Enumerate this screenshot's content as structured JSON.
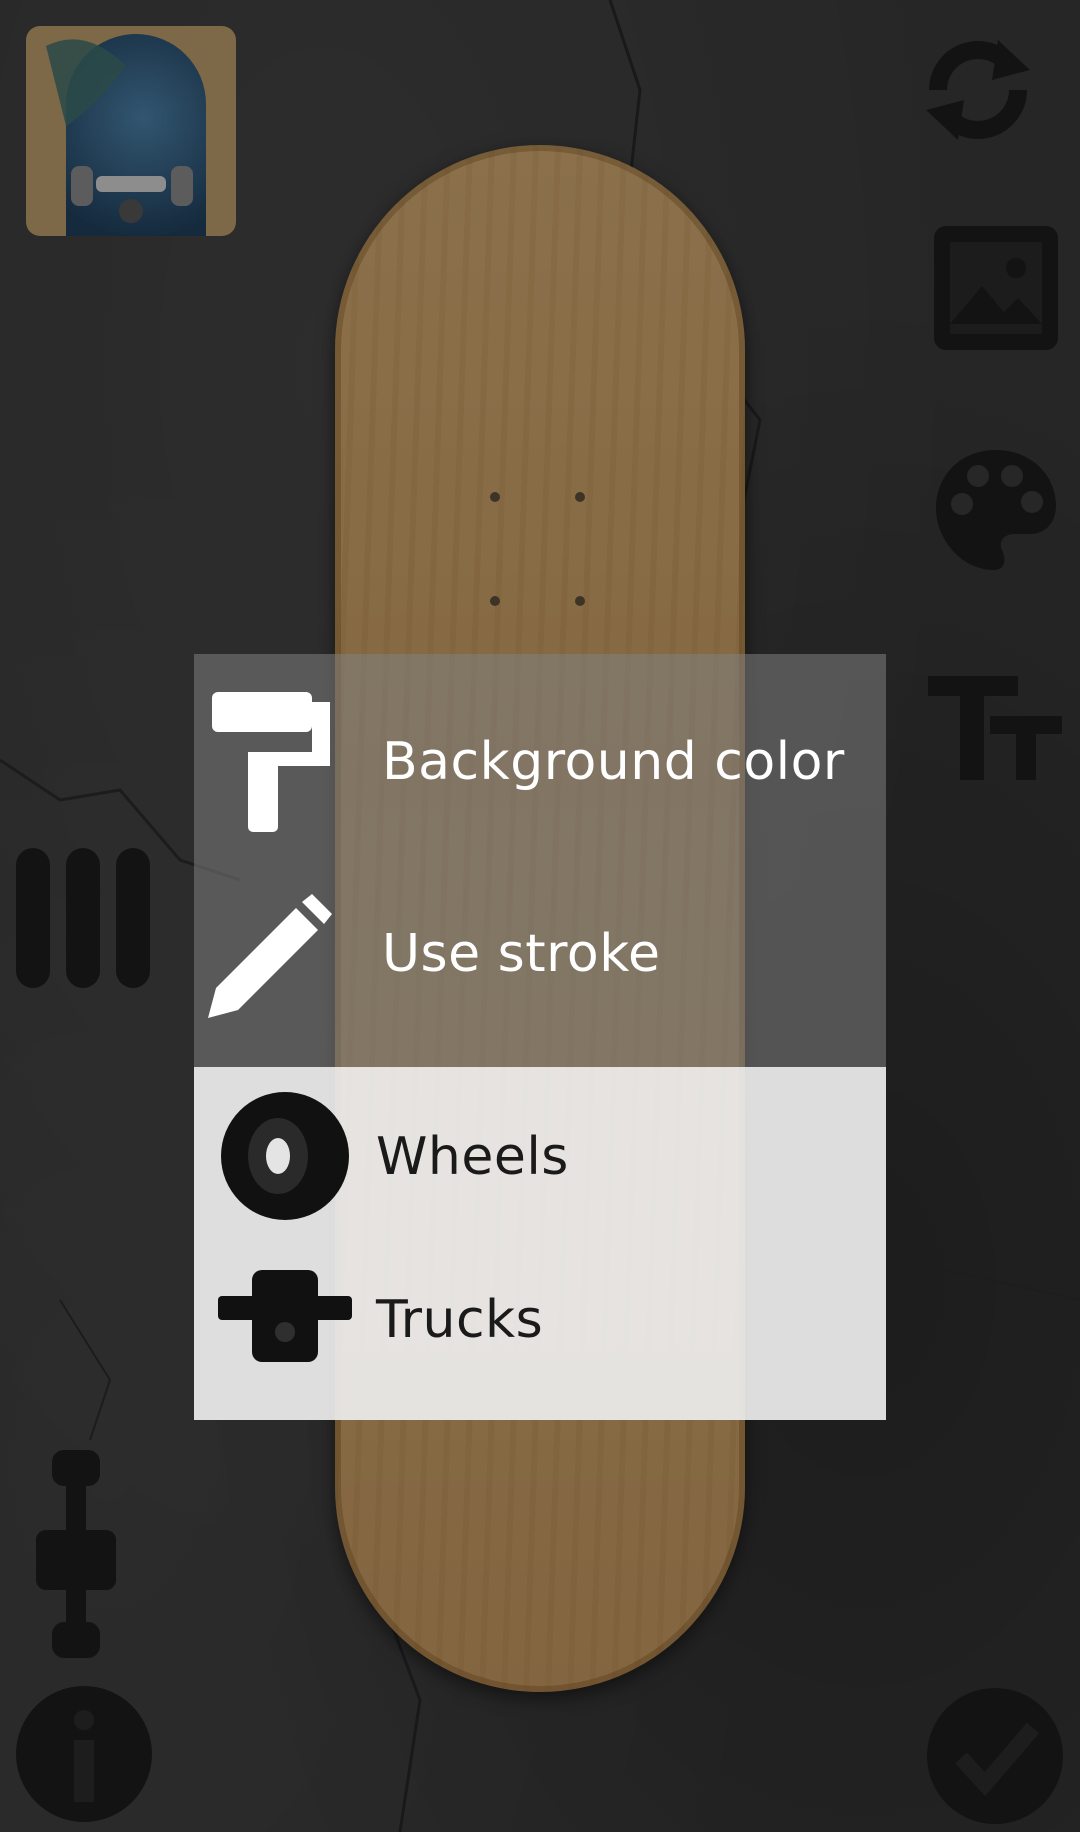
{
  "menu": {
    "items": [
      {
        "label": "Background color",
        "icon": "paint-roller-icon"
      },
      {
        "label": "Use stroke",
        "icon": "pencil-icon"
      },
      {
        "label": "Wheels",
        "icon": "wheel-icon"
      },
      {
        "label": "Trucks",
        "icon": "truck-icon"
      }
    ]
  },
  "toolbar": {
    "right": [
      "rotate-icon",
      "image-icon",
      "palette-icon",
      "text-size-icon",
      "checkmark-icon"
    ],
    "left": [
      "deck-preview-thumbnail",
      "grip-tape-icon",
      "truck-side-icon",
      "info-icon"
    ]
  },
  "colors": {
    "background": "#393939",
    "deck": "#c89f67",
    "menu_top": "#808080",
    "menu_bottom": "#eeeeee"
  }
}
